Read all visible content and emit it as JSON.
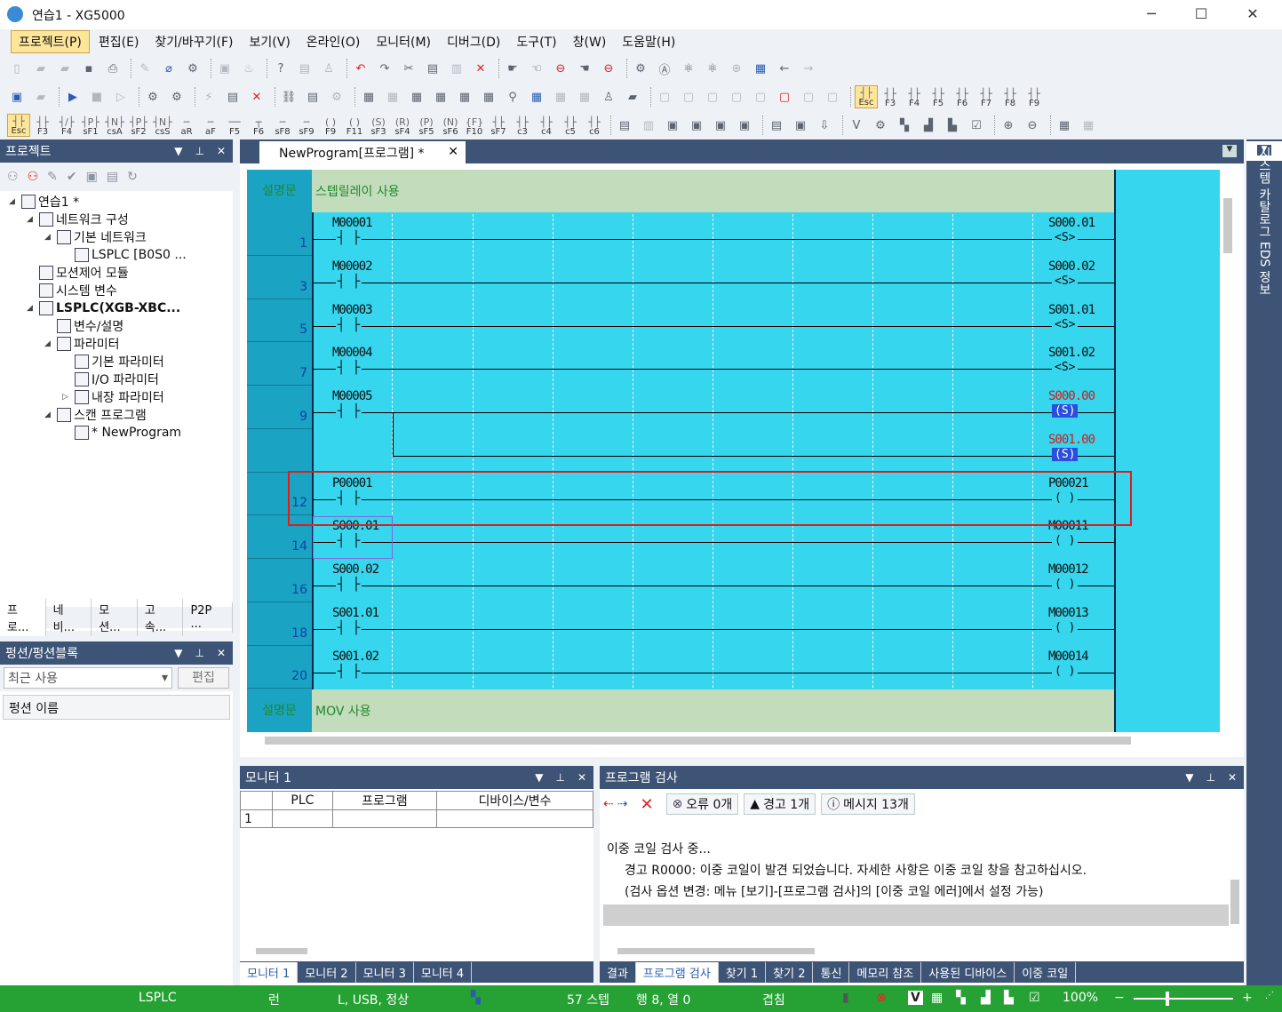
{
  "window": {
    "title": "연습1 - XG5000",
    "minimize": "─",
    "maximize": "☐",
    "close": "✕"
  },
  "menu": [
    "프로젝트(P)",
    "편집(E)",
    "찾기/바꾸기(F)",
    "보기(V)",
    "온라인(O)",
    "모니터(M)",
    "디버그(D)",
    "도구(T)",
    "창(W)",
    "도움말(H)"
  ],
  "toolbar3_keys": [
    {
      "g": "┤├",
      "k": "Esc"
    },
    {
      "g": "┤├",
      "k": "F3"
    },
    {
      "g": "┤/├",
      "k": "F4"
    },
    {
      "g": "┤P├",
      "k": "sF1"
    },
    {
      "g": "┤N├",
      "k": "csA"
    },
    {
      "g": "┤P├",
      "k": "sF2"
    },
    {
      "g": "┤N├",
      "k": "csS"
    },
    {
      "g": "─",
      "k": "aR"
    },
    {
      "g": "─",
      "k": "aF"
    },
    {
      "g": "──",
      "k": "F5"
    },
    {
      "g": "┬",
      "k": "F6"
    },
    {
      "g": "─",
      "k": "sF8"
    },
    {
      "g": "─",
      "k": "sF9"
    },
    {
      "g": "( )",
      "k": "F9"
    },
    {
      "g": "( )",
      "k": "F11"
    },
    {
      "g": "(S)",
      "k": "sF3"
    },
    {
      "g": "(R)",
      "k": "sF4"
    },
    {
      "g": "(P)",
      "k": "sF5"
    },
    {
      "g": "(N)",
      "k": "sF6"
    },
    {
      "g": "{F}",
      "k": "F10"
    },
    {
      "g": "┤├",
      "k": "sF7"
    },
    {
      "g": "┤├",
      "k": "c3"
    },
    {
      "g": "┤├",
      "k": "c4"
    },
    {
      "g": "┤├",
      "k": "c5"
    },
    {
      "g": "┤├",
      "k": "c6"
    }
  ],
  "toolbar2_keys": [
    "Esc",
    "F3",
    "F4",
    "F5",
    "F6",
    "F7",
    "F8",
    "F9"
  ],
  "project": {
    "title": "프로젝트",
    "tree": [
      {
        "label": "연습1 *",
        "depth": 0,
        "icon": "project-icon",
        "bold": false
      },
      {
        "label": "네트워크 구성",
        "depth": 1,
        "icon": "network-icon",
        "bold": false
      },
      {
        "label": "기본 네트워크",
        "depth": 2,
        "icon": "network-base-icon",
        "bold": false
      },
      {
        "label": "LSPLC [B0S0 ...",
        "depth": 3,
        "icon": "plc-module-icon",
        "bold": false
      },
      {
        "label": "모션제어 모듈",
        "depth": 1,
        "icon": "motion-module-icon",
        "bold": false
      },
      {
        "label": "시스템 변수",
        "depth": 1,
        "icon": "system-variable-icon",
        "bold": false
      },
      {
        "label": "LSPLC(XGB-XBC...",
        "depth": 1,
        "icon": "plc-icon",
        "bold": true
      },
      {
        "label": "변수/설명",
        "depth": 2,
        "icon": "variable-icon",
        "bold": false
      },
      {
        "label": "파라미터",
        "depth": 2,
        "icon": "parameter-icon",
        "bold": false
      },
      {
        "label": "기본 파라미터",
        "depth": 3,
        "icon": "basic-param-icon",
        "bold": false
      },
      {
        "label": "I/O 파라미터",
        "depth": 3,
        "icon": "io-param-icon",
        "bold": false
      },
      {
        "label": "내장 파라미터",
        "depth": 3,
        "icon": "builtin-param-icon",
        "bold": false
      },
      {
        "label": "스캔 프로그램",
        "depth": 2,
        "icon": "scan-program-icon",
        "bold": false
      },
      {
        "label": "* NewProgram",
        "depth": 3,
        "icon": "ld-program-icon",
        "bold": false
      }
    ],
    "tabs": [
      "프로...",
      "네비...",
      "모션...",
      "고속...",
      "P2P ..."
    ]
  },
  "functions": {
    "title": "펑션/펑션블록",
    "dropdown": "최근 사용",
    "edit": "편집",
    "list_header": "펑션 이름"
  },
  "editor": {
    "tab": "NewProgram[프로그램] *",
    "comments": [
      {
        "key": "설명문",
        "text": "스텝릴레이 사용"
      },
      {
        "key": "설명문",
        "text": "MOV 사용"
      }
    ],
    "rungs": [
      {
        "num": "1",
        "contact": "M00001",
        "coil": "S000.01",
        "coil_type": "<S>",
        "coil_red": false
      },
      {
        "num": "3",
        "contact": "M00002",
        "coil": "S000.02",
        "coil_type": "<S>",
        "coil_red": false
      },
      {
        "num": "5",
        "contact": "M00003",
        "coil": "S001.01",
        "coil_type": "<S>",
        "coil_red": false
      },
      {
        "num": "7",
        "contact": "M00004",
        "coil": "S001.02",
        "coil_type": "<S>",
        "coil_red": false
      },
      {
        "num": "9",
        "contact": "M00005",
        "coil": "S000.00",
        "coil_type": "(S)",
        "coil_red": true
      },
      {
        "num": "",
        "contact": "",
        "coil": "S001.00",
        "coil_type": "(S)",
        "coil_red": true
      },
      {
        "num": "12",
        "contact": "P00001",
        "coil": "P00021",
        "coil_type": "( )",
        "coil_red": false
      },
      {
        "num": "14",
        "contact": "S000.01",
        "coil": "M00011",
        "coil_type": "( )",
        "coil_red": false
      },
      {
        "num": "16",
        "contact": "S000.02",
        "coil": "M00012",
        "coil_type": "( )",
        "coil_red": false
      },
      {
        "num": "18",
        "contact": "S001.01",
        "coil": "M00013",
        "coil_type": "( )",
        "coil_red": false
      },
      {
        "num": "20",
        "contact": "S001.02",
        "coil": "M00014",
        "coil_type": "( )",
        "coil_red": false
      }
    ]
  },
  "monitor": {
    "title": "모니터 1",
    "cols": [
      "PLC",
      "프로그램",
      "디바이스/변수"
    ],
    "row1": "1",
    "tabs": [
      "모니터 1",
      "모니터 2",
      "모니터 3",
      "모니터 4"
    ]
  },
  "check": {
    "title": "프로그램 검사",
    "errors": "오류 0개",
    "warnings": "경고 1개",
    "messages": "메시지 13개",
    "lines": [
      "이중 코일 검사 중...",
      "경고 R0000: 이중 코일이 발견 되었습니다. 자세한 사항은 이중 코일 창을 참고하십시오.",
      "(검사 옵션 변경: 메뉴 [보기]-[프로그램 검사]의 [이중 코일 에러]에서 설정 가능)"
    ],
    "tabs": [
      "결과",
      "프로그램 검사",
      "찾기 1",
      "찾기 2",
      "통신",
      "메모리 참조",
      "사용된 디바이스",
      "이중 코일"
    ]
  },
  "sidebar": {
    "text": "시스템 카탈로그 EDS 정보"
  },
  "status": {
    "plc": "LSPLC",
    "mode": "런",
    "conn": "L, USB, 정상",
    "steps": "57 스텝",
    "pos": "행 8, 열 0",
    "overwrite": "겹침",
    "zoom": "100%"
  },
  "colors": {
    "ladder_bg": "#35d6ee",
    "label_col": "#1aa3c2",
    "comment_bg": "#c2dcbc",
    "highlight": "#e21b1b",
    "statusbar": "#25a233",
    "panel_header": "#3d5476"
  }
}
